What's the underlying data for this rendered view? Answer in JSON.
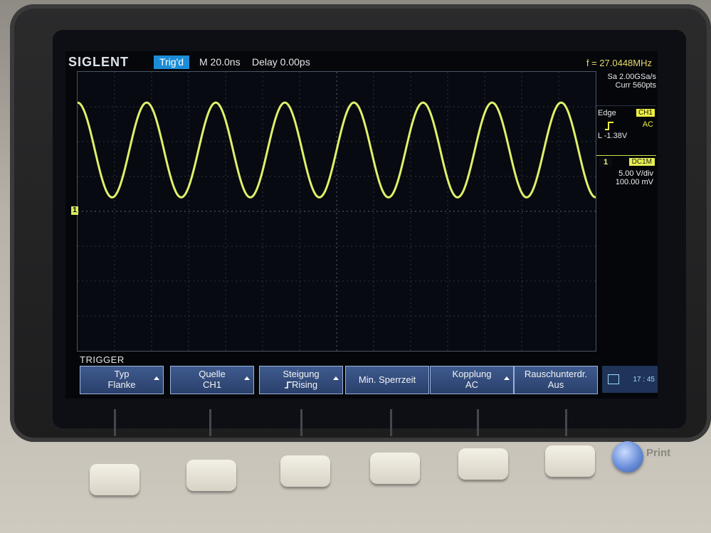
{
  "header": {
    "brand": "SIGLENT",
    "trigger_status": "Trig'd",
    "timebase": "M 20.0ns",
    "delay": "Delay 0.00ps",
    "frequency": "f = 27.0448MHz"
  },
  "side_panel": {
    "sample_rate": "Sa 2.00GSa/s",
    "curr_pts": "Curr 560pts",
    "trigger_type": "Edge",
    "trigger_source": "CH1",
    "slope_icon": "rising-edge-icon",
    "coupling": "AC",
    "level": "L  -1.38V",
    "channel_number": "1",
    "channel_coupling_badge": "DC1M",
    "volts_per_div": "5.00 V/div",
    "offset": "100.00 mV"
  },
  "waveform": {
    "channel_marker": "1",
    "color": "#dff06a",
    "cycles_visible": 7.5,
    "high_level_fraction": 0.11,
    "low_level_fraction": 0.45
  },
  "menu": {
    "title": "TRIGGER",
    "buttons": [
      {
        "line1": "Typ",
        "line2": "Flanke",
        "arrow": true
      },
      {
        "line1": "Quelle",
        "line2": "CH1",
        "arrow": true
      },
      {
        "line1": "Steigung",
        "line2": "Rising",
        "arrow": true
      },
      {
        "line1": "Min. Sperrzeit",
        "line2": "",
        "arrow": false
      },
      {
        "line1": "Kopplung",
        "line2": "AC",
        "arrow": true
      },
      {
        "line1": "Rauschunterdr.",
        "line2": "Aus",
        "arrow": false
      }
    ],
    "status_time": "17 : 45"
  },
  "hardware": {
    "print_label": "Print"
  }
}
